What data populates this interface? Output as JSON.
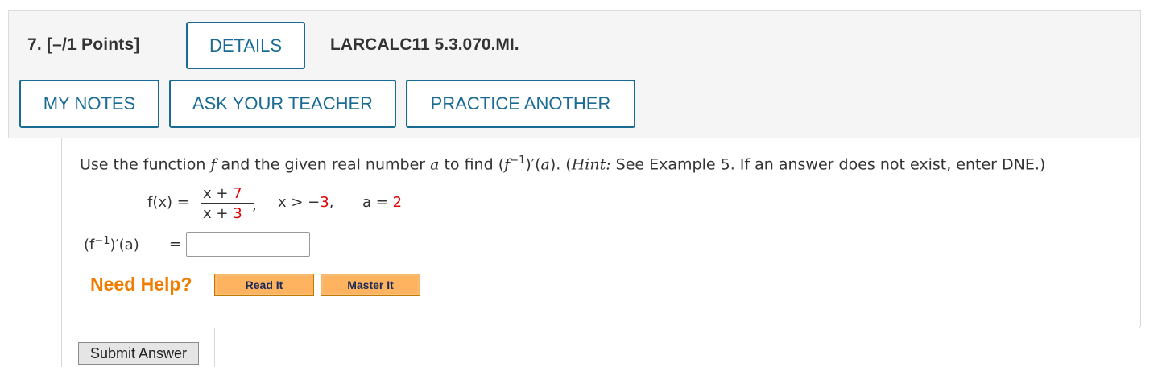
{
  "header": {
    "question_number": "7.",
    "points": "[–/1 Points]",
    "details_label": "DETAILS",
    "problem_code": "LARCALC11 5.3.070.MI.",
    "my_notes_label": "MY NOTES",
    "ask_teacher_label": "ASK YOUR TEACHER",
    "practice_another_label": "PRACTICE ANOTHER"
  },
  "question": {
    "prompt_part1": "Use the function ",
    "var_f": "f",
    "prompt_part2": " and the given real number ",
    "var_a": "a",
    "prompt_part3": " to find (",
    "prompt_part4": ")′(",
    "prompt_part5": "). (",
    "hint_label": "Hint:",
    "prompt_part6": " See Example 5. If an answer does not exist, enter DNE.)",
    "superscript": "−1",
    "function_lhs": "f(x) =",
    "numerator_var": "x + ",
    "numerator_const": "7",
    "denominator_var": "x + ",
    "denominator_const": "3",
    "comma": ",",
    "domain_prefix": "x > −",
    "domain_value": "3",
    "domain_comma": ",",
    "a_prefix": "a = ",
    "a_value": "2",
    "answer_lhs_open": "(f",
    "answer_lhs_close": ")′(a)",
    "answer_equals": "=",
    "answer_value": ""
  },
  "help": {
    "need_help_label": "Need Help?",
    "read_it_label": "Read It",
    "master_it_label": "Master It"
  },
  "submit_label": "Submit Answer",
  "colors": {
    "accent": "#1a6b93",
    "highlight_red": "#e00000",
    "need_help_orange": "#f07d00",
    "help_button_fill": "#fdb35f"
  }
}
